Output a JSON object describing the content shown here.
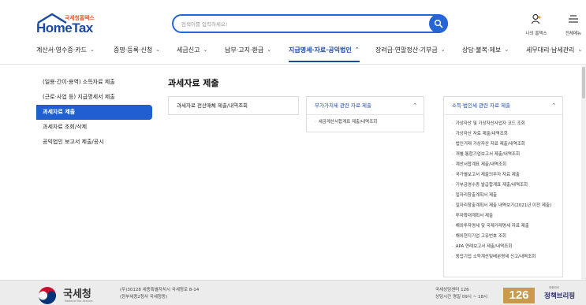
{
  "header": {
    "logo": {
      "small": "국세청홈택스",
      "big": "HomeTax"
    },
    "search": {
      "placeholder": "검색어를 입력하세요!"
    },
    "my_hometax_label": "나의 홈택스",
    "all_menu_label": "전체메뉴"
  },
  "nav": {
    "items": [
      {
        "label": "계산서·영수증·카드"
      },
      {
        "label": "증명·등록·신청"
      },
      {
        "label": "세금신고"
      },
      {
        "label": "납부·고지·환급"
      },
      {
        "label": "지급명세·자료·공익법인"
      },
      {
        "label": "장려금·연말정산·기부금"
      },
      {
        "label": "상담·불복·제보"
      },
      {
        "label": "세무대리·납세관리"
      }
    ]
  },
  "sidebar": {
    "items": [
      {
        "label": "(일용·간이·용역) 소득자료 제출"
      },
      {
        "label": "(근로·사업 등) 지급명세서 제출"
      },
      {
        "label": "과세자료 제출"
      },
      {
        "label": "과세자료 조회/삭제"
      },
      {
        "label": "공익법인 보고서 제출/공시"
      }
    ]
  },
  "main": {
    "title": "과세자료 제출",
    "cards": {
      "electronic": {
        "title": "과세자료 전산매체 제출/내역조회"
      },
      "vat": {
        "title": "부가가치세 관련 자료 제출",
        "links": [
          "세금계산서합계표 제출/내역조회"
        ]
      },
      "income": {
        "title": "소득·법인세 관련 자료 제출",
        "links": [
          "가상자산 및 가상자산사업자 코드 조회",
          "가상자산 자료 제출/내역조회",
          "법인거래 가상자산 자료 제출/내역조회",
          "개별·통합기업보고서 제출/내역조회",
          "계산서합계표 제출/내역조회",
          "국가별보고서 제출의무자 자료 제출",
          "기부금영수증 발급합계표 제출/내역조회",
          "일자리창출계획서 제출",
          "일자리창출계획서 제출 내역보기(2021년 이전 제출)",
          "투자확대계획서 제출",
          "해외투자명세 및 국제거래명세 자료 제출",
          "해외현지기업 고유번호 조회",
          "APA 연례보고서 제출/내역조회",
          "동업기업 소득계산및배분명세 신고/내역조회"
        ]
      }
    }
  },
  "footer": {
    "agency_ko": "국세청",
    "agency_en": "National Tax Service",
    "address_line1": "(우)30128 세종특별자치시 국세청로 8-14",
    "address_line2": "(정부세종2청사 국세청동)",
    "call_center": "국세상담센터 126",
    "hours": "상담시간 평일 09시 ~ 18시",
    "badge": "126",
    "briefing_small": "대한민국",
    "briefing_main": "정책브리핑"
  },
  "colors": {
    "accent": "#2465d8",
    "nav_active": "#1a4aa3",
    "sidebar_active": "#1f5fcf",
    "footer_bg": "#ececec"
  },
  "icons": [
    "search-icon",
    "person-icon",
    "menu-icon",
    "chevron-down-icon",
    "chevron-up-icon",
    "emblem-icon"
  ]
}
